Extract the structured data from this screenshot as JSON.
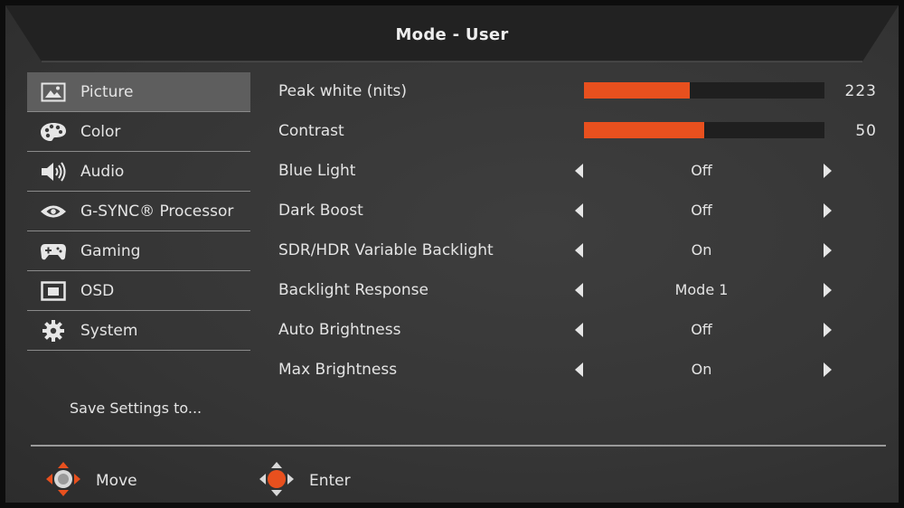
{
  "header": {
    "title": "Mode - User"
  },
  "sidebar": {
    "items": [
      {
        "label": "Picture",
        "icon": "picture-icon",
        "active": true
      },
      {
        "label": "Color",
        "icon": "palette-icon",
        "active": false
      },
      {
        "label": "Audio",
        "icon": "speaker-icon",
        "active": false
      },
      {
        "label": "G-SYNC® Processor",
        "icon": "nvidia-eye-icon",
        "active": false
      },
      {
        "label": "Gaming",
        "icon": "gamepad-icon",
        "active": false
      },
      {
        "label": "OSD",
        "icon": "osd-icon",
        "active": false
      },
      {
        "label": "System",
        "icon": "gear-icon",
        "active": false
      }
    ],
    "save_label": "Save Settings to..."
  },
  "settings": {
    "sliders": [
      {
        "label": "Peak white (nits)",
        "value": "223",
        "fill_fraction": 0.44
      },
      {
        "label": "Contrast",
        "value": "50",
        "fill_fraction": 0.5
      }
    ],
    "options": [
      {
        "label": "Blue Light",
        "value": "Off"
      },
      {
        "label": "Dark Boost",
        "value": "Off"
      },
      {
        "label": "SDR/HDR Variable Backlight",
        "value": "On"
      },
      {
        "label": "Backlight Response",
        "value": "Mode 1"
      },
      {
        "label": "Auto Brightness",
        "value": "Off"
      },
      {
        "label": "Max Brightness",
        "value": "On"
      }
    ]
  },
  "footer": {
    "move_label": "Move",
    "enter_label": "Enter"
  },
  "colors": {
    "accent": "#e8501e",
    "active_item_bg": "#5e5e5e",
    "background": "#363636"
  }
}
